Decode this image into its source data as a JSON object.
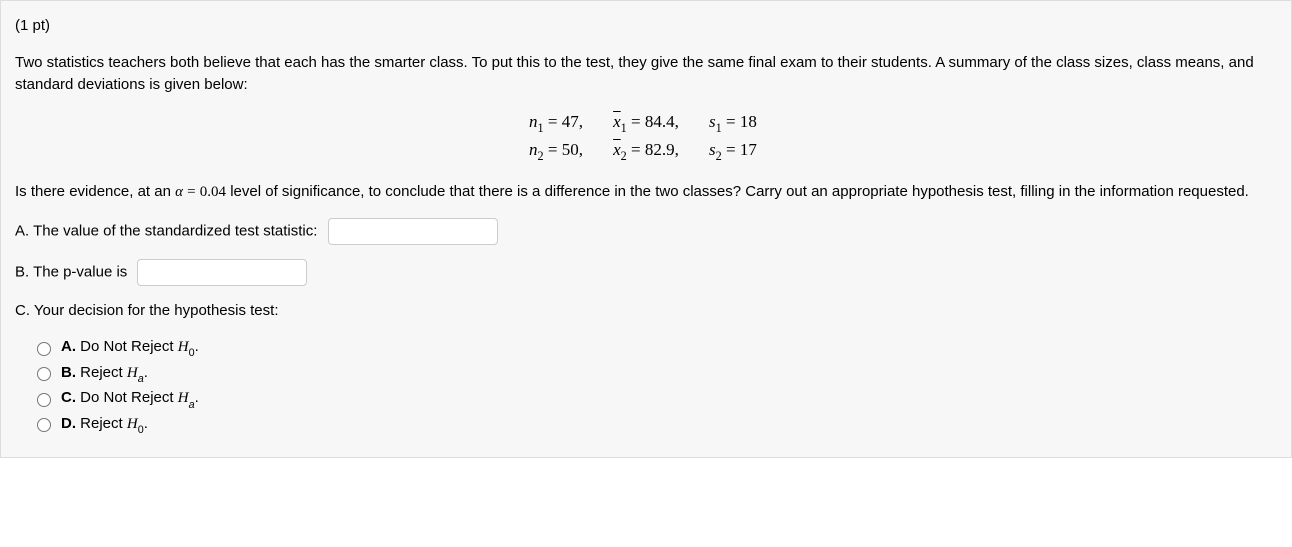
{
  "points": "(1 pt)",
  "intro": "Two statistics teachers both believe that each has the smarter class. To put this to the test, they give the same final exam to their students. A summary of the class sizes, class means, and standard deviations is given below:",
  "stats": {
    "row1": {
      "n": "47",
      "xbar": "84.4",
      "s": "18"
    },
    "row2": {
      "n": "50",
      "xbar": "82.9",
      "s": "17"
    }
  },
  "question_pre": "Is there evidence, at an ",
  "alpha_eq": "α = 0.04",
  "question_post": " level of significance, to conclude that there is a difference in the two classes? Carry out an appropriate hypothesis test, filling in the information requested.",
  "partA": "A. The value of the standardized test statistic:",
  "partB": "B. The p-value is",
  "partC": "C. Your decision for the hypothesis test:",
  "options": {
    "a": {
      "label": "A.",
      "text": " Do Not Reject ",
      "hyp": "H",
      "sub": "0",
      "dot": "."
    },
    "b": {
      "label": "B.",
      "text": " Reject ",
      "hyp": "H",
      "sub": "a",
      "dot": "."
    },
    "c": {
      "label": "C.",
      "text": " Do Not Reject ",
      "hyp": "H",
      "sub": "a",
      "dot": "."
    },
    "d": {
      "label": "D.",
      "text": " Reject ",
      "hyp": "H",
      "sub": "0",
      "dot": "."
    }
  }
}
